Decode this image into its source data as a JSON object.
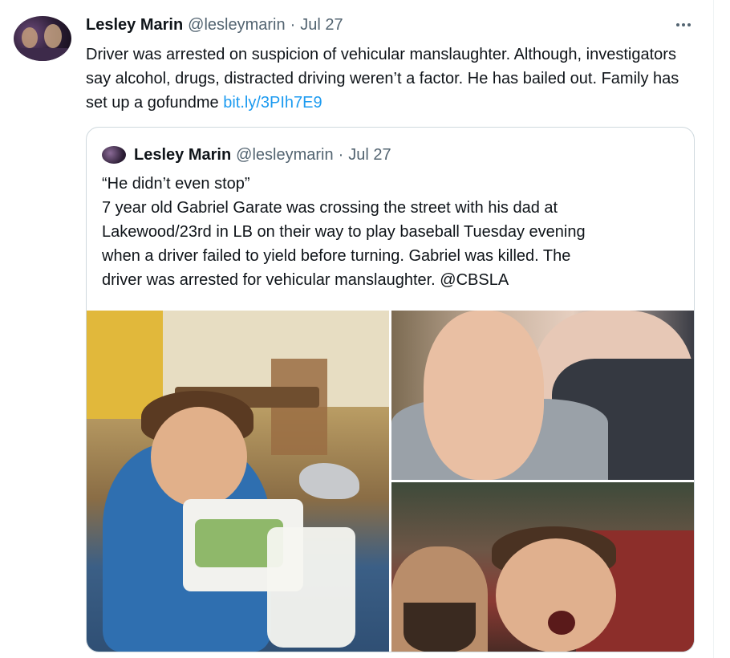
{
  "tweet": {
    "author_name": "Lesley Marin",
    "handle": "@lesleymarin",
    "separator": "·",
    "date": "Jul 27",
    "more_icon": "more-horizontal-icon",
    "text_main": "Driver was arrested on suspicion of vehicular manslaughter. Although, investigators say alcohol, drugs, distracted driving weren’t a factor. He has bailed out. Family has set up a gofundme ",
    "link_text": "bit.ly/3PIh7E9"
  },
  "quoted_tweet": {
    "author_name": "Lesley Marin",
    "handle": "@lesleymarin",
    "separator": "·",
    "date": "Jul 27",
    "lines": [
      "“He didn’t even stop”",
      "7 year old Gabriel Garate was crossing the street with his dad at",
      "Lakewood/23rd in LB on their way to play baseball Tuesday evening",
      "when a driver failed to yield before turning. Gabriel was killed. The",
      "driver was arrested for vehicular manslaughter. @CBSLA"
    ]
  },
  "colors": {
    "text": "#0f1419",
    "secondary": "#536471",
    "link": "#1d9bf0",
    "border": "#cfd9de"
  }
}
